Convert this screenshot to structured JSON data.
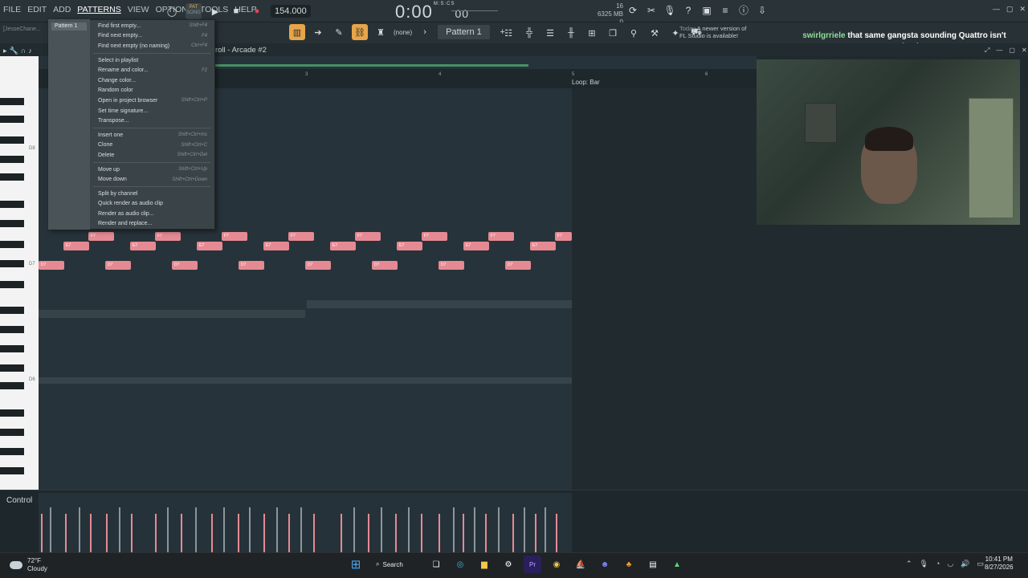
{
  "menubar": [
    "FILE",
    "EDIT",
    "ADD",
    "PATTERNS",
    "VIEW",
    "OPTIONS",
    "TOOLS",
    "HELP"
  ],
  "transport": {
    "mode_label": "PAT",
    "mode_sub": "SONG",
    "bpm": "154.000",
    "time": "0:00",
    "time_sub": "00",
    "time_unit": "M:S:CS"
  },
  "cpu": {
    "line1": "16",
    "mem": "6325 MB",
    "line3": "0"
  },
  "toolbar2": {
    "project_hint": "[JesseChane...",
    "none_label": "(none)",
    "pattern": "Pattern 1"
  },
  "news": {
    "when": "Today",
    "line1": "A newer version of",
    "line2": "FL Studio is available!"
  },
  "chat": {
    "user": "swirlgrriele",
    "message": "that same gangsta sounding Quattro isn't cutting it"
  },
  "piano_roll": {
    "title": "roll - Arcade #2",
    "loop_label": "Loop: Bar",
    "bars": [
      "3",
      "4",
      "5",
      "6"
    ],
    "key_labels": [
      "D8",
      "D7",
      "D6"
    ]
  },
  "notes": {
    "e7": "E7",
    "f7": "F7",
    "d7": "D7"
  },
  "control": {
    "label": "Control"
  },
  "patterns_menu": {
    "selected_pattern": "Pattern 1",
    "groups": [
      [
        {
          "label": "Find first empty...",
          "shortcut": "Shift+F4"
        },
        {
          "label": "Find next empty...",
          "shortcut": "F4"
        },
        {
          "label": "Find next empty (no naming)",
          "shortcut": "Ctrl+F4"
        }
      ],
      [
        {
          "label": "Select in playlist",
          "shortcut": ""
        },
        {
          "label": "Rename and color...",
          "shortcut": "F2"
        },
        {
          "label": "Change color...",
          "shortcut": ""
        },
        {
          "label": "Random color",
          "shortcut": ""
        },
        {
          "label": "Open in project browser",
          "shortcut": "Shift+Ctrl+P"
        },
        {
          "label": "Set time signature...",
          "shortcut": ""
        },
        {
          "label": "Transpose...",
          "shortcut": ""
        }
      ],
      [
        {
          "label": "Insert one",
          "shortcut": "Shift+Ctrl+Ins"
        },
        {
          "label": "Clone",
          "shortcut": "Shift+Ctrl+C"
        },
        {
          "label": "Delete",
          "shortcut": "Shift+Ctrl+Del"
        }
      ],
      [
        {
          "label": "Move up",
          "shortcut": "Shift+Ctrl+Up"
        },
        {
          "label": "Move down",
          "shortcut": "Shift+Ctrl+Down"
        }
      ],
      [
        {
          "label": "Split by channel",
          "shortcut": ""
        },
        {
          "label": "Quick render as audio clip",
          "shortcut": ""
        },
        {
          "label": "Render as audio clip...",
          "shortcut": ""
        },
        {
          "label": "Render and replace...",
          "shortcut": ""
        }
      ]
    ]
  },
  "taskbar": {
    "temp": "72°F",
    "weather": "Cloudy",
    "search": "Search",
    "time": "10:41 PM",
    "date": "8/27/2026"
  },
  "colors": {
    "note": "#e58a93",
    "accent": "#e7a54a",
    "chat_user": "#8fe09a"
  }
}
